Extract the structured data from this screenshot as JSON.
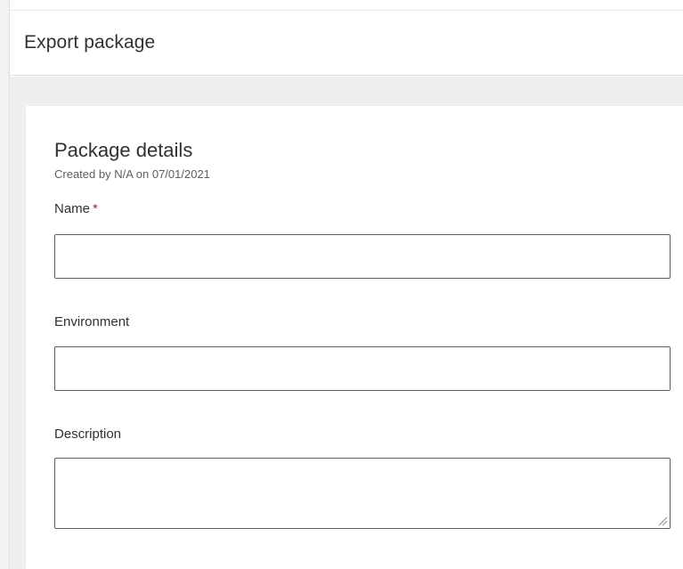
{
  "header": {
    "title": "Export package"
  },
  "section": {
    "title": "Package details",
    "subtitle": "Created by N/A on 07/01/2021"
  },
  "fields": {
    "name": {
      "label": "Name",
      "required_marker": "*",
      "value": "",
      "placeholder": ""
    },
    "environment": {
      "label": "Environment",
      "value": "",
      "placeholder": ""
    },
    "description": {
      "label": "Description",
      "value": "",
      "placeholder": ""
    }
  },
  "colors": {
    "required": "#a4262c",
    "background": "#efefef",
    "border": "#605e5c"
  },
  "icons": {
    "resize": "resize-grip-icon"
  }
}
